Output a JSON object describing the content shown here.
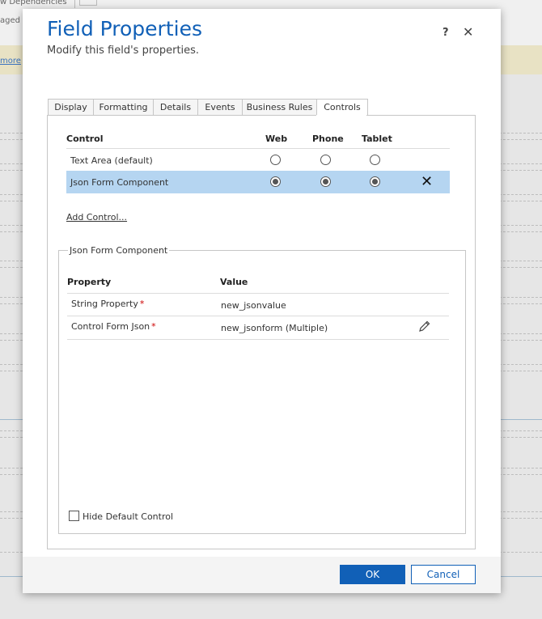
{
  "background": {
    "top_text_1": "w Dependencies",
    "top_text_2": "aged",
    "banner_link": "more"
  },
  "dialog": {
    "title": "Field Properties",
    "subtitle": "Modify this field's properties.",
    "help_label": "?",
    "close_label": "✕"
  },
  "tabs": [
    {
      "label": "Display",
      "active": false
    },
    {
      "label": "Formatting",
      "active": false
    },
    {
      "label": "Details",
      "active": false
    },
    {
      "label": "Events",
      "active": false
    },
    {
      "label": "Business Rules",
      "active": false
    },
    {
      "label": "Controls",
      "active": true
    }
  ],
  "controls": {
    "headers": {
      "control": "Control",
      "web": "Web",
      "phone": "Phone",
      "tablet": "Tablet"
    },
    "rows": [
      {
        "name": "Text Area (default)",
        "web": false,
        "phone": false,
        "tablet": false,
        "selected": false
      },
      {
        "name": "Json Form Component",
        "web": true,
        "phone": true,
        "tablet": true,
        "selected": true
      }
    ],
    "add_link": "Add Control..."
  },
  "component": {
    "legend": "Json Form Component",
    "headers": {
      "property": "Property",
      "value": "Value"
    },
    "rows": [
      {
        "property": "String Property",
        "required": "*",
        "value": "new_jsonvalue"
      },
      {
        "property": "Control Form Json",
        "required": "*",
        "value": "new_jsonform (Multiple)"
      }
    ],
    "hide_default_label": "Hide Default Control"
  },
  "footer": {
    "ok_label": "OK",
    "cancel_label": "Cancel"
  },
  "colors": {
    "accent": "#1160b7",
    "selected_row": "#b5d5f1"
  }
}
